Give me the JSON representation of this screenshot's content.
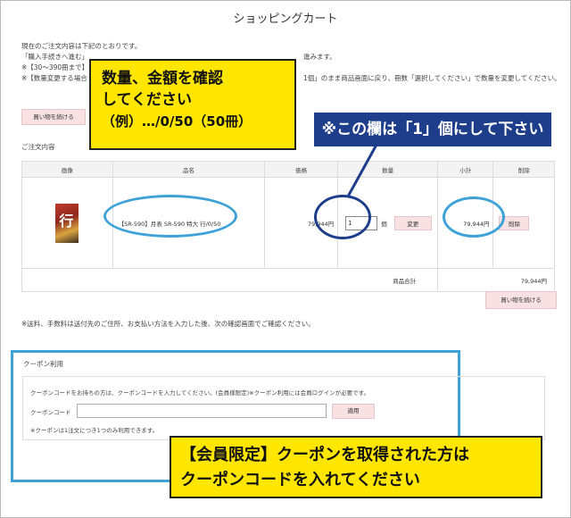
{
  "page": {
    "title": "ショッピングカート"
  },
  "intro": {
    "line1": "現在のご注文内容は下記のとおりです。",
    "line2": "「購入手続きへ進む」",
    "line2_tail": "進みます。",
    "line3": "※【30～390冊まで】",
    "line4": "※【数量変更する場合",
    "line4_tail": "1個」のまま商品画面に戻り、冊数「選択してください」で数量を変更してください。"
  },
  "buttons": {
    "continue_shopping_top": "買い物を続ける",
    "continue_shopping_bottom": "買い物を続ける",
    "change": "変更",
    "delete": "削除",
    "apply": "適用"
  },
  "cart": {
    "section_label": "ご注文内容",
    "columns": [
      "画像",
      "品名",
      "価格",
      "数量",
      "小計",
      "削除"
    ],
    "items": [
      {
        "name": "【SR-590】月表 SR-590 特大 行/0/50",
        "price": "79,944円",
        "quantity": "1",
        "unit": "個",
        "subtotal": "79,944円",
        "image_char": "行"
      }
    ],
    "total_label": "商品合計",
    "total_value": "79,944円"
  },
  "note_shipping": "※送料、手数料は送付先のご住所、お支払い方法を入力した後、次の確認画面でご確認ください。",
  "coupon": {
    "title": "クーポン利用",
    "description": "クーポンコードをお持ちの方は、クーポンコードを入力してください。(会員様限定)※クーポン利用には会員ログインが必要です。",
    "input_label": "クーポンコード",
    "input_value": "",
    "note": "※クーポンは1注文につき1つのみ利用できます。"
  },
  "callouts": {
    "yellow_top_line1": "数量、金額を確認",
    "yellow_top_line2": "してください",
    "yellow_top_line3": "（例）…/0/50（50冊）",
    "navy_qty": "※この欄は「1」個にして下さい",
    "yellow_bottom_line1": "【会員限定】クーポンを取得された方は",
    "yellow_bottom_line2": "クーポンコードを入れてください"
  },
  "colors": {
    "highlight_blue": "#3ea2d9",
    "callout_yellow": "#ffe600",
    "callout_navy": "#1e3d8a",
    "button_pink": "#f7e1e3"
  }
}
